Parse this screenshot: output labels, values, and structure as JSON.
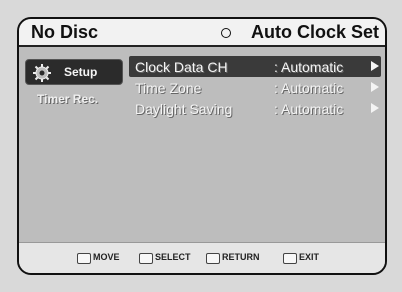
{
  "header": {
    "disc_status": "No Disc",
    "page_title": "Auto Clock Set"
  },
  "sidebar": {
    "items": [
      {
        "label": "Setup",
        "icon": "gear-icon",
        "active": true
      },
      {
        "label": "Timer Rec.",
        "icon": "timer-icon",
        "active": false
      }
    ]
  },
  "menu": {
    "rows": [
      {
        "label": "Clock Data CH",
        "value": ": Automatic",
        "selected": true
      },
      {
        "label": "Time Zone",
        "value": ": Automatic",
        "selected": false
      },
      {
        "label": "Daylight Saving",
        "value": ": Automatic",
        "selected": false
      }
    ]
  },
  "footer": {
    "hints": [
      {
        "label": "MOVE",
        "icon": "move-icon"
      },
      {
        "label": "SELECT",
        "icon": "select-icon"
      },
      {
        "label": "RETURN",
        "icon": "return-icon"
      },
      {
        "label": "EXIT",
        "icon": "exit-icon"
      }
    ]
  }
}
